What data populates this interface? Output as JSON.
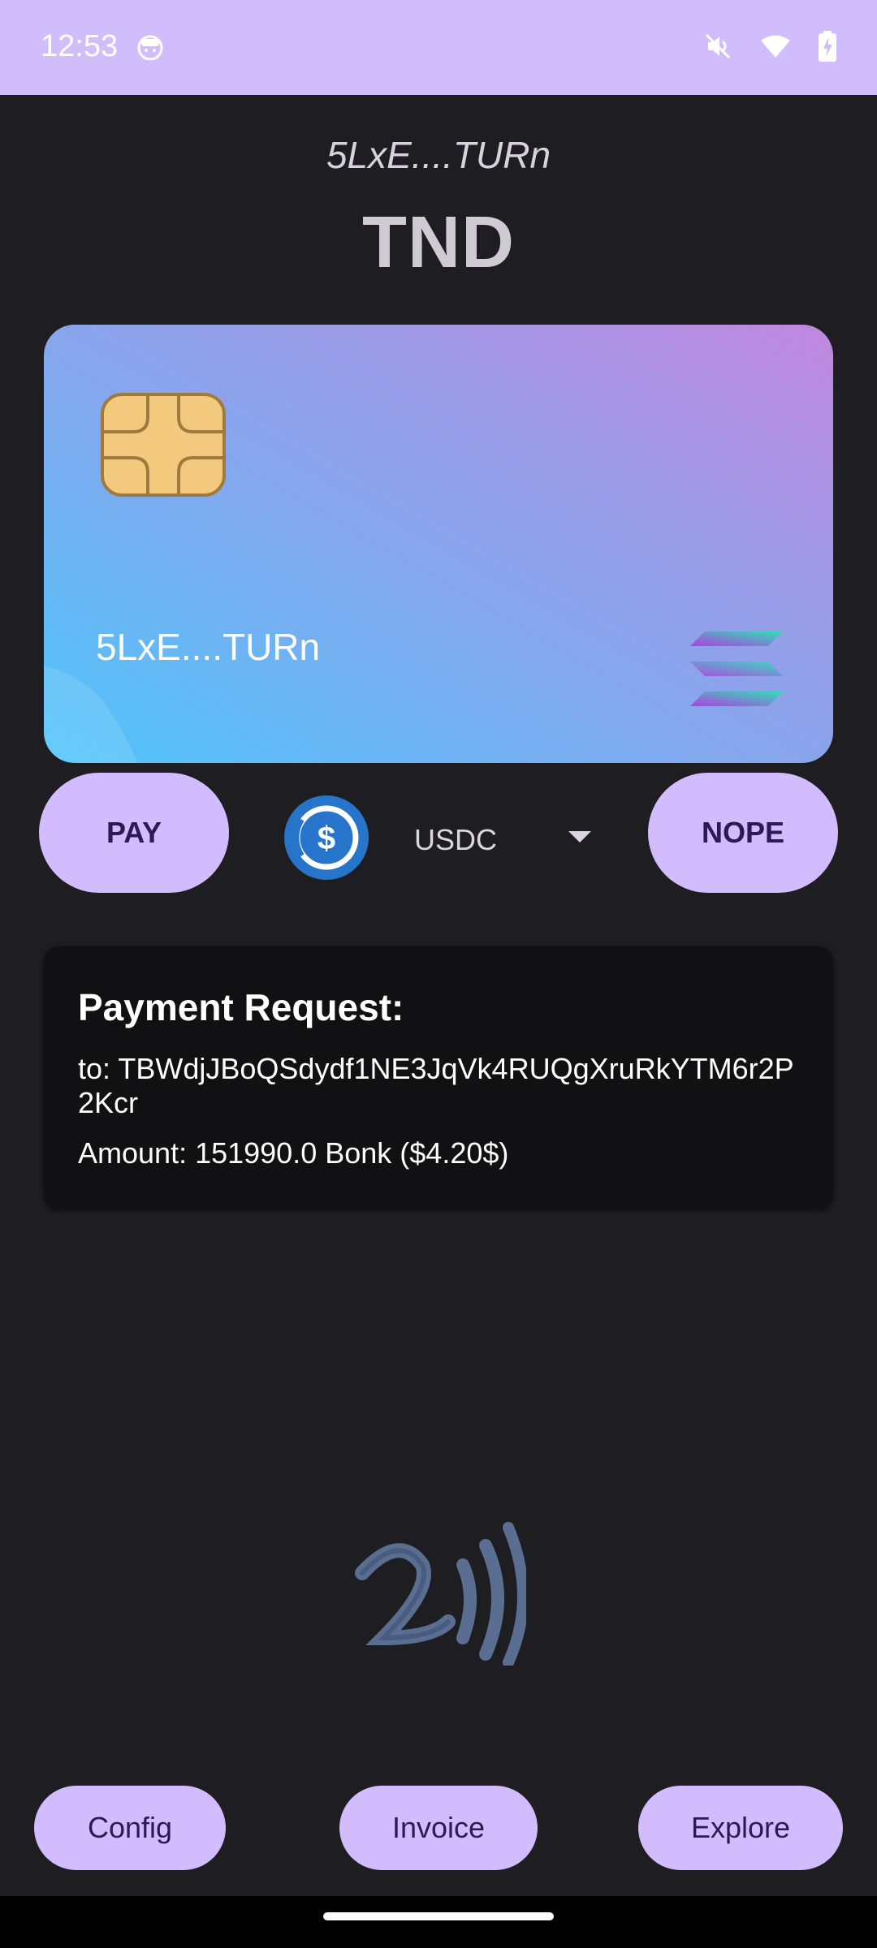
{
  "status_bar": {
    "time": "12:53",
    "icons": [
      "robot-icon",
      "mute-icon",
      "wifi-icon",
      "battery-charging-icon"
    ]
  },
  "header": {
    "wallet_short": "5LxE....TURn",
    "token": "TND"
  },
  "card": {
    "address": "5LxE....TURn",
    "icons": [
      "chip-icon",
      "solana-logo-icon"
    ],
    "gradient": [
      "#4ec5fb",
      "#c187df"
    ]
  },
  "actions": {
    "pay_label": "PAY",
    "nope_label": "NOPE",
    "token_selected": "USDC"
  },
  "payment_request": {
    "title": "Payment Request:",
    "to": "to: TBWdjJBoQSdydf1NE3JqVk4RUQgXruRkYTM6r2P2Kcr",
    "amount": "Amount: 151990.0 Bonk ($4.20$)"
  },
  "bottom_nav": {
    "config_label": "Config",
    "invoice_label": "Invoice",
    "explore_label": "Explore"
  },
  "colors": {
    "status_bar": "#d1bdfb",
    "background": "#1e1e22",
    "button": "#d3bcfd",
    "button_text": "#2c1a55"
  }
}
